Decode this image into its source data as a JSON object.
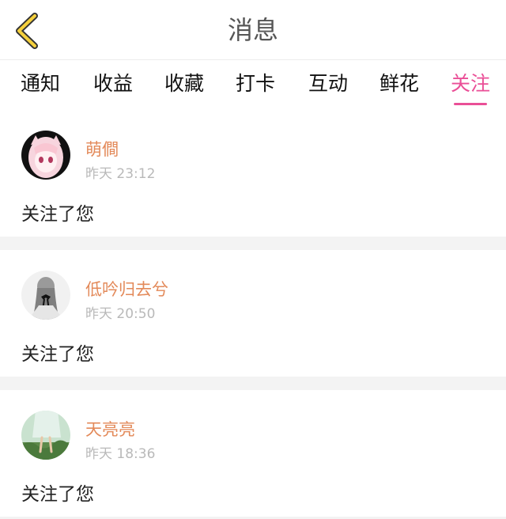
{
  "header": {
    "title": "消息",
    "back_icon": "chevron-left-icon",
    "accent": "#f5d03c"
  },
  "tabs": [
    {
      "label": "通知"
    },
    {
      "label": "收益"
    },
    {
      "label": "收藏"
    },
    {
      "label": "打卡"
    },
    {
      "label": "互动"
    },
    {
      "label": "鲜花"
    },
    {
      "label": "关注",
      "active": true
    }
  ],
  "colors": {
    "active_tab": "#ea4f97",
    "username": "#e38a5a",
    "time": "#b9b9b9",
    "separator": "#f3f3f3"
  },
  "messages": [
    {
      "username": "萌僴",
      "time": "昨天 23:12",
      "text": "关注了您",
      "avatar": "anime-girl-avatar"
    },
    {
      "username": "低吟归去兮",
      "time": "昨天 20:50",
      "text": "关注了您",
      "avatar": "girl-back-avatar"
    },
    {
      "username": "天亮亮",
      "time": "昨天 18:36",
      "text": "关注了您",
      "avatar": "garden-dress-avatar"
    }
  ]
}
